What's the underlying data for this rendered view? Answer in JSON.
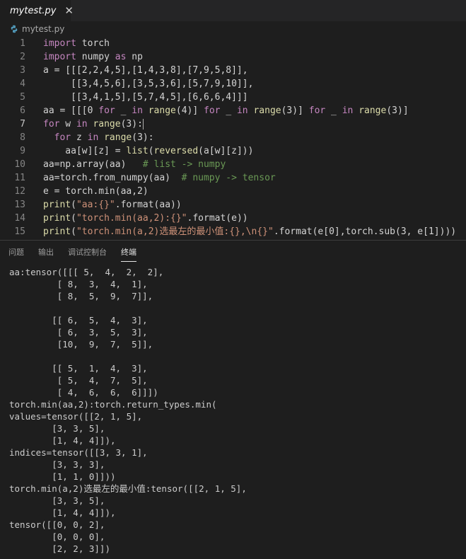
{
  "tab": {
    "title": "mytest.py",
    "close": "✕"
  },
  "breadcrumb": {
    "file": "mytest.py"
  },
  "editor": {
    "lines": [
      {
        "n": "1",
        "html": "<span class='kw'>import</span> torch"
      },
      {
        "n": "2",
        "html": "<span class='kw'>import</span> numpy <span class='kw'>as</span> np"
      },
      {
        "n": "3",
        "html": "a = [[[2,2,4,5],[1,4,3,8],[7,9,5,8]],"
      },
      {
        "n": "4",
        "html": "     [[3,4,5,6],[3,5,3,6],[5,7,9,10]],"
      },
      {
        "n": "5",
        "html": "     [[3,4,1,5],[5,7,4,5],[6,6,6,4]]]"
      },
      {
        "n": "6",
        "html": "aa = [[[0 <span class='kw'>for</span> _ <span class='kw'>in</span> <span class='fn'>range</span>(4)] <span class='kw'>for</span> _ <span class='kw'>in</span> <span class='fn'>range</span>(3)] <span class='kw'>for</span> _ <span class='kw'>in</span> <span class='fn'>range</span>(3)]"
      },
      {
        "n": "7",
        "html": "<span class='kw'>for</span> w <span class='kw'>in</span> <span class='fn'>range</span>(3):<span class='cursor'></span>"
      },
      {
        "n": "8",
        "html": "  <span class='kw'>for</span> z <span class='kw'>in</span> <span class='fn'>range</span>(3):"
      },
      {
        "n": "9",
        "html": "    aa[w][z] = <span class='fn'>list</span>(<span class='fn'>reversed</span>(a[w][z]))"
      },
      {
        "n": "10",
        "html": "aa=np.array(aa)   <span class='cm'># list -&gt; numpy</span>"
      },
      {
        "n": "11",
        "html": "aa=torch.from_numpy(aa)  <span class='cm'># numpy -&gt; tensor</span>"
      },
      {
        "n": "12",
        "html": "e = torch.min(aa,2)"
      },
      {
        "n": "13",
        "html": "<span class='fn'>print</span>(<span class='str'>\"aa:{}\"</span>.format(aa))"
      },
      {
        "n": "14",
        "html": "<span class='fn'>print</span>(<span class='str'>\"torch.min(aa,2):{}\"</span>.format(e))"
      },
      {
        "n": "15",
        "html": "<span class='fn'>print</span>(<span class='str'>\"torch.min(a,2)选最左的最小值:{},\\n{}\"</span>.format(e[0],torch.sub(3, e[1])))"
      }
    ]
  },
  "panel": {
    "tabs": [
      "问题",
      "输出",
      "调试控制台",
      "终端"
    ],
    "active_tab": "终端"
  },
  "terminal": {
    "output": "aa:tensor([[[ 5,  4,  2,  2],\n         [ 8,  3,  4,  1],\n         [ 8,  5,  9,  7]],\n\n        [[ 6,  5,  4,  3],\n         [ 6,  3,  5,  3],\n         [10,  9,  7,  5]],\n\n        [[ 5,  1,  4,  3],\n         [ 5,  4,  7,  5],\n         [ 4,  6,  6,  6]]])\ntorch.min(aa,2):torch.return_types.min(\nvalues=tensor([[2, 1, 5],\n        [3, 3, 5],\n        [1, 4, 4]]),\nindices=tensor([[3, 3, 1],\n        [3, 3, 3],\n        [1, 1, 0]]))\ntorch.min(a,2)选最左的最小值:tensor([[2, 1, 5],\n        [3, 3, 5],\n        [1, 4, 4]]),\ntensor([[0, 0, 2],\n        [0, 0, 0],\n        [2, 2, 3]])"
  },
  "colors": {
    "keyword": "#c586c0",
    "function": "#dcdcaa",
    "string": "#ce9178",
    "comment": "#6a9955",
    "background": "#1e1e1e"
  },
  "icons": {
    "tab_file": "python-icon",
    "breadcrumb_file": "python-icon",
    "close": "close-icon"
  }
}
